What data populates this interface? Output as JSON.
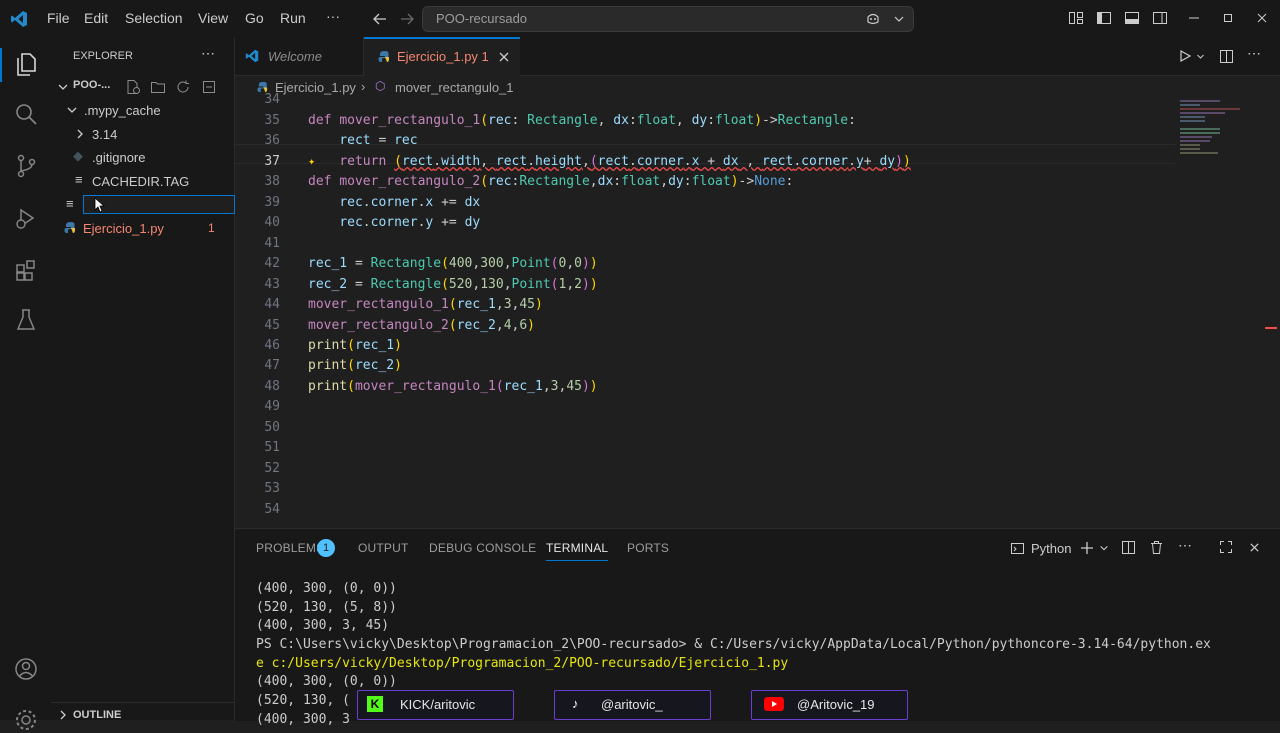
{
  "menu": [
    "File",
    "Edit",
    "Selection",
    "View",
    "Go",
    "Run",
    "···"
  ],
  "command_center": "POO-recursado",
  "explorer": {
    "title": "EXPLORER",
    "root": "POO-...",
    "items": [
      {
        "label": ".mypy_cache",
        "kind": "folder-open"
      },
      {
        "label": "3.14",
        "kind": "folder"
      },
      {
        "label": ".gitignore",
        "kind": "file"
      },
      {
        "label": "CACHEDIR.TAG",
        "kind": "file"
      },
      {
        "label": "",
        "kind": "new-file-input"
      },
      {
        "label": "Ejercicio_1.py",
        "kind": "python",
        "badge": "1"
      }
    ],
    "outline": "OUTLINE"
  },
  "tabs": [
    {
      "label": "Welcome"
    },
    {
      "label": "Ejercicio_1.py 1"
    }
  ],
  "breadcrumb": {
    "file": "Ejercicio_1.py",
    "symbol": "mover_rectangulo_1"
  },
  "code_lines": [
    "34",
    "35",
    "36",
    "37",
    "38",
    "39",
    "40",
    "41",
    "42",
    "43",
    "44",
    "45",
    "46",
    "47",
    "48",
    "49",
    "50",
    "51",
    "52",
    "53",
    "54"
  ],
  "panel": {
    "tabs": [
      "PROBLEMS",
      "OUTPUT",
      "DEBUG CONSOLE",
      "TERMINAL",
      "PORTS"
    ],
    "problems_badge": "1",
    "shell": "Python",
    "terminal": [
      "(400, 300, (0, 0))",
      "(520, 130, (5, 8))",
      "(400, 300, 3, 45)",
      "PS C:\\Users\\vicky\\Desktop\\Programacion_2\\POO-recursado> & C:/Users/vicky/AppData/Local/Python/pythoncore-3.14-64/python.ex",
      "e c:/Users/vicky/Desktop/Programacion_2/POO-recursado/Ejercicio_1.py",
      "(400, 300, (0, 0))",
      "(520, 130, (",
      "(400, 300, 3"
    ]
  },
  "overlays": {
    "kick": "KICK/aritovic",
    "tiktok": "@aritovic_",
    "youtube": "@Aritovic_19"
  }
}
